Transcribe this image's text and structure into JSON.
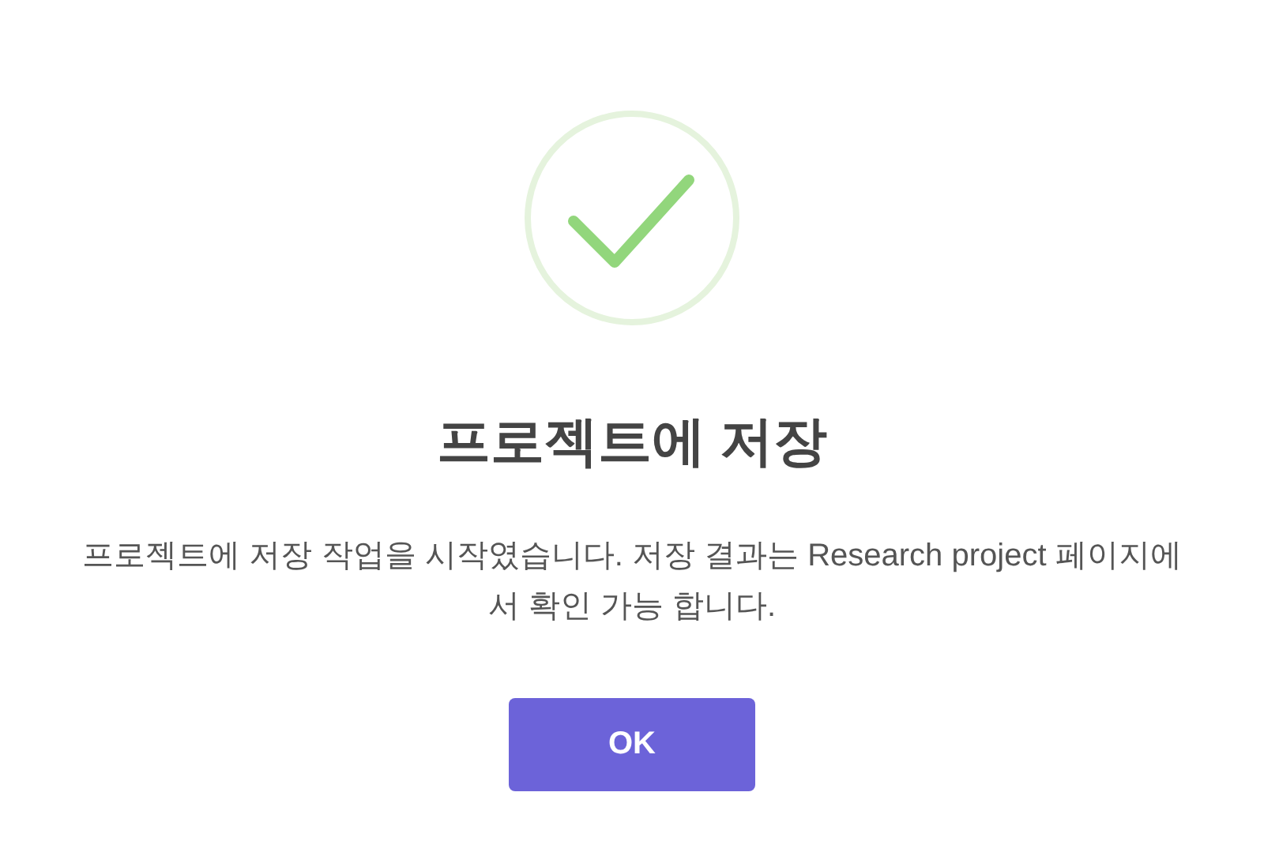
{
  "dialog": {
    "title": "프로젝트에 저장",
    "message": "프로젝트에 저장 작업을 시작였습니다. 저장 결과는 Research project 페이지에서 확인 가능 합니다.",
    "buttons": [
      {
        "label": "OK"
      }
    ]
  }
}
